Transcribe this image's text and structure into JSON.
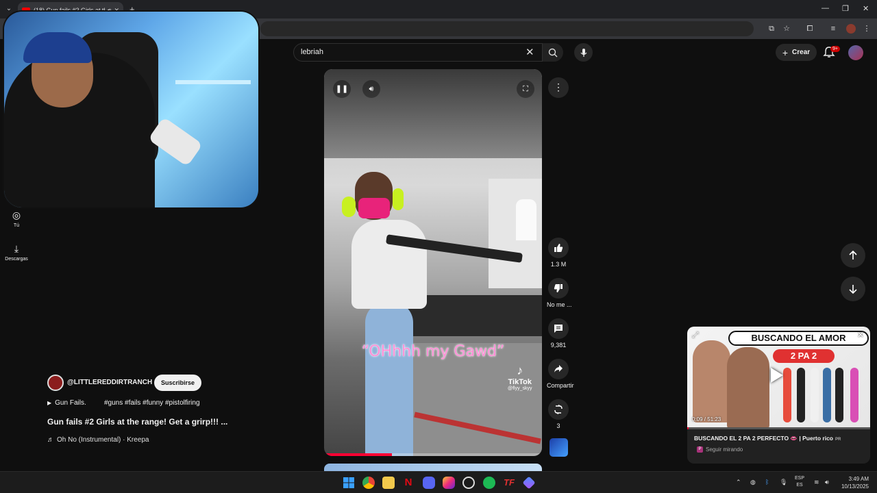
{
  "browser": {
    "tab_title": "(18) Gun fails #2 Girls at the",
    "new_tab": "+",
    "window_controls": [
      "—",
      "❐",
      "✕"
    ]
  },
  "header": {
    "search_query": "lebriah",
    "create_label": "Crear",
    "notifications_badge": "9+"
  },
  "sidebar": {
    "items": [
      {
        "label": "Tú",
        "icon": "account-icon"
      },
      {
        "label": "Descargas",
        "icon": "download-icon"
      }
    ]
  },
  "short": {
    "caption": "“OHhhh my Gawd”",
    "watermark_brand": "TikTok",
    "watermark_handle": "@flyy_skyy",
    "progress": 0.31
  },
  "actions": {
    "like_count": "1.3 M",
    "dislike_label": "No me ...",
    "comment_count": "9,381",
    "share_label": "Compartir",
    "remix_count": "3"
  },
  "metadata": {
    "channel": "@LITTLEREDDIRTRANCH",
    "subscribe_label": "Suscribirse",
    "playlist": "Gun Fails.",
    "hashtags": "#guns #fails #funny #pistolfiring",
    "title": "Gun fails #2 Girls at the range! Get a grirp!!!  ...",
    "music": "Oh No (Instrumental) · Kreepa"
  },
  "miniplayer": {
    "banner": "BUSCANDO EL AMOR",
    "pill": "2 PA 2",
    "time": "0:09 / 51:23",
    "progress": 0.003,
    "title": "BUSCANDO EL 2 PA 2 PERFECTO 👄 | Puerto rico",
    "title_badge": "PR",
    "subtitle": "Seguir mirando",
    "subtitle_badge": "P"
  },
  "taskbar": {
    "lang_top": "ESP",
    "lang_bottom": "ES",
    "time": "3:49 AM",
    "date": "10/13/2025"
  },
  "colors": {
    "accent_red": "#ff0033",
    "background": "#0f0f0f",
    "caption_pink": "#ff8fd6"
  }
}
